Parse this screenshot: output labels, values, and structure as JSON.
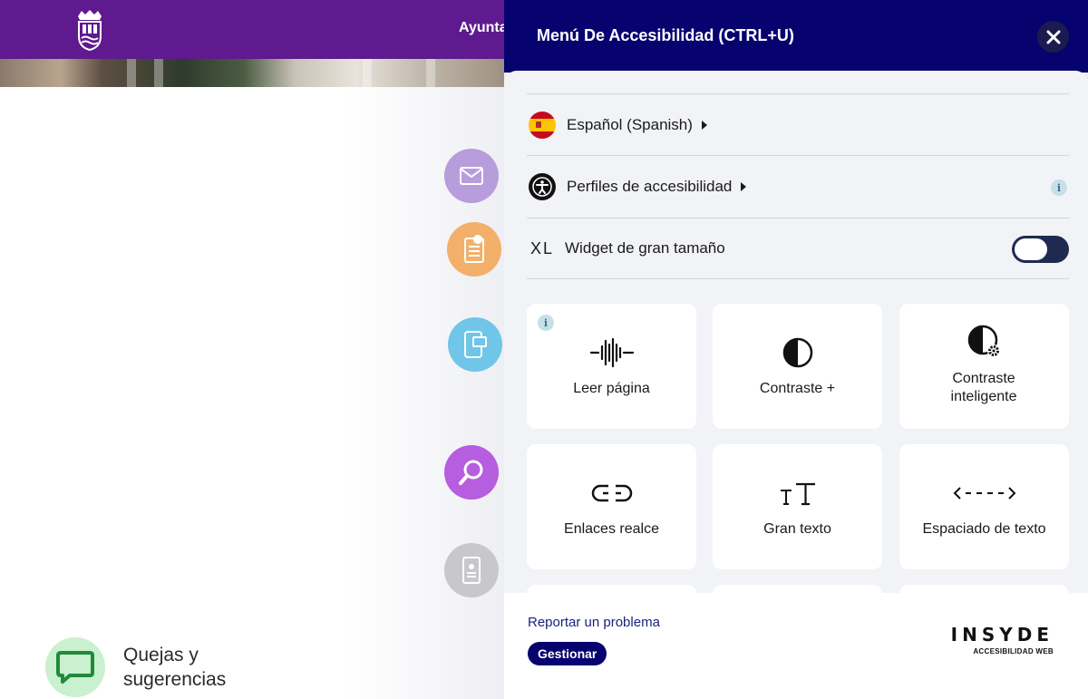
{
  "site": {
    "header_link": "Ayunta",
    "feedback_label_line1": "Quejas y",
    "feedback_label_line2": "sugerencias"
  },
  "panel": {
    "title": "Menú De Accesibilidad (CTRL+U)",
    "language_label": "Español (Spanish)",
    "profiles_label": "Perfiles de accesibilidad",
    "info_glyph": "i",
    "xl_glyph": "XL",
    "large_widget_label": "Widget de gran tamaño",
    "large_widget_enabled": false,
    "cards": [
      {
        "label": "Leer página",
        "icon": "soundwave-icon"
      },
      {
        "label": "Contraste +",
        "icon": "contrast-icon"
      },
      {
        "label": "Contraste inteligente",
        "icon": "smart-contrast-icon"
      },
      {
        "label": "Enlaces realce",
        "icon": "link-icon"
      },
      {
        "label": "Gran texto",
        "icon": "text-size-icon"
      },
      {
        "label": "Espaciado de texto",
        "icon": "text-spacing-icon"
      }
    ],
    "footer": {
      "report_label": "Reportar un problema",
      "manage_label": "Gestionar",
      "brand_name": "INSYDE",
      "brand_sub": "ACCESIBILIDAD WEB"
    }
  },
  "colors": {
    "site_header": "#5e1a8e",
    "panel_header": "#06036f",
    "toggle_off": "#1e2a50"
  }
}
